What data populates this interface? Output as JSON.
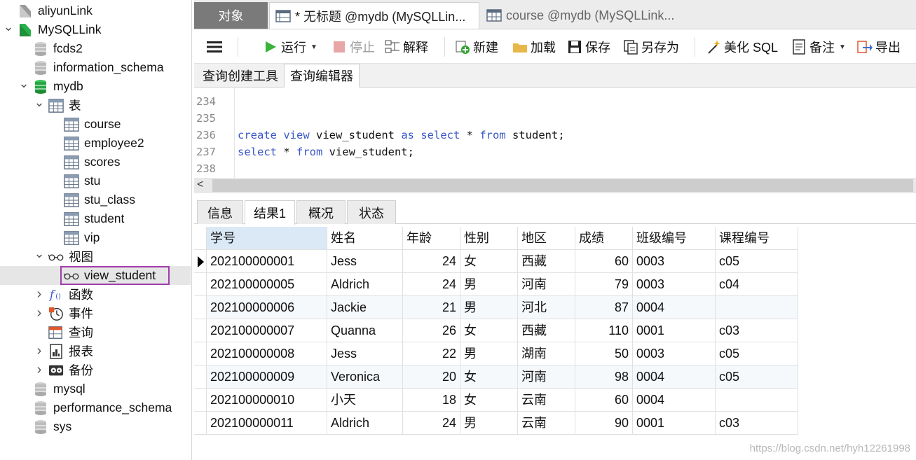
{
  "sidebar": {
    "items": [
      {
        "label": "aliyunLink",
        "icon": "connection-icon-inactive"
      },
      {
        "label": "MySQLLink",
        "icon": "connection-icon-active",
        "arrow": "expanded"
      },
      {
        "label": "fcds2",
        "icon": "database-icon"
      },
      {
        "label": "information_schema",
        "icon": "database-icon"
      },
      {
        "label": "mydb",
        "icon": "database-icon-active",
        "arrow": "expanded"
      },
      {
        "label": "表",
        "icon": "table-folder-icon",
        "arrow": "expanded"
      },
      {
        "label": "course",
        "icon": "table-icon"
      },
      {
        "label": "employee2",
        "icon": "table-icon"
      },
      {
        "label": "scores",
        "icon": "table-icon"
      },
      {
        "label": "stu",
        "icon": "table-icon"
      },
      {
        "label": "stu_class",
        "icon": "table-icon"
      },
      {
        "label": "student",
        "icon": "table-icon"
      },
      {
        "label": "vip",
        "icon": "table-icon"
      },
      {
        "label": "视图",
        "icon": "view-icon",
        "arrow": "expanded"
      },
      {
        "label": "view_student",
        "icon": "view-icon",
        "selected": true
      },
      {
        "label": "函数",
        "icon": "function-icon",
        "arrow": "collapsed"
      },
      {
        "label": "事件",
        "icon": "event-icon",
        "arrow": "collapsed"
      },
      {
        "label": "查询",
        "icon": "query-icon"
      },
      {
        "label": "报表",
        "icon": "report-icon",
        "arrow": "collapsed"
      },
      {
        "label": "备份",
        "icon": "backup-icon",
        "arrow": "collapsed"
      },
      {
        "label": "mysql",
        "icon": "database-icon"
      },
      {
        "label": "performance_schema",
        "icon": "database-icon"
      },
      {
        "label": "sys",
        "icon": "database-icon"
      }
    ]
  },
  "tabs": {
    "objects": "对象",
    "query1": "* 无标题 @mydb (MySQLLin...",
    "query2": "course @mydb (MySQLLink..."
  },
  "toolbar": {
    "menu": "menu-icon",
    "run": "运行",
    "stop": "停止",
    "explain": "解释",
    "new": "新建",
    "load": "加载",
    "save": "保存",
    "save_as": "另存为",
    "beautify": "美化 SQL",
    "comment": "备注",
    "export": "导出"
  },
  "subtabs": {
    "builder": "查询创建工具",
    "editor": "查询编辑器"
  },
  "editor": {
    "lines": [
      {
        "n": "234",
        "tokens": []
      },
      {
        "n": "235",
        "tokens": []
      },
      {
        "n": "236",
        "tokens": [
          {
            "t": "create",
            "k": "kw"
          },
          {
            "t": " ",
            "k": "id"
          },
          {
            "t": "view",
            "k": "kw"
          },
          {
            "t": " view_student ",
            "k": "id"
          },
          {
            "t": "as",
            "k": "kw"
          },
          {
            "t": " ",
            "k": "id"
          },
          {
            "t": "select",
            "k": "kw"
          },
          {
            "t": " * ",
            "k": "id"
          },
          {
            "t": "from",
            "k": "kw"
          },
          {
            "t": " student;",
            "k": "id"
          }
        ]
      },
      {
        "n": "237",
        "tokens": [
          {
            "t": "select",
            "k": "kw"
          },
          {
            "t": " * ",
            "k": "id"
          },
          {
            "t": "from",
            "k": "kw"
          },
          {
            "t": " view_student;",
            "k": "id"
          }
        ]
      },
      {
        "n": "238",
        "tokens": []
      }
    ],
    "scroll_left": "<"
  },
  "result_tabs": [
    "信息",
    "结果1",
    "概况",
    "状态"
  ],
  "grid": {
    "columns": [
      "学号",
      "姓名",
      "年龄",
      "性别",
      "地区",
      "成绩",
      "班级编号",
      "课程编号"
    ],
    "rows": [
      [
        "202100000001",
        "Jess",
        "24",
        "女",
        "西藏",
        "60",
        "0003",
        "c05"
      ],
      [
        "202100000005",
        "Aldrich",
        "24",
        "男",
        "河南",
        "79",
        "0003",
        "c04"
      ],
      [
        "202100000006",
        "Jackie",
        "21",
        "男",
        "河北",
        "87",
        "0004",
        ""
      ],
      [
        "202100000007",
        "Quanna",
        "26",
        "女",
        "西藏",
        "110",
        "0001",
        "c03"
      ],
      [
        "202100000008",
        "Jess",
        "22",
        "男",
        "湖南",
        "50",
        "0003",
        "c05"
      ],
      [
        "202100000009",
        "Veronica",
        "20",
        "女",
        "河南",
        "98",
        "0004",
        "c05"
      ],
      [
        "202100000010",
        "小天",
        "18",
        "女",
        "云南",
        "60",
        "0004",
        ""
      ],
      [
        "202100000011",
        "Aldrich",
        "24",
        "男",
        "云南",
        "90",
        "0001",
        "c03"
      ]
    ]
  },
  "watermark": "https://blog.csdn.net/hyh12261998"
}
